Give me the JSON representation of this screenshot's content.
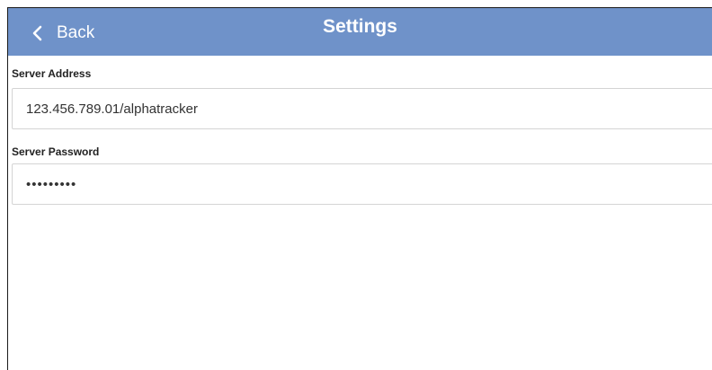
{
  "header": {
    "back_label": "Back",
    "title": "Settings",
    "background_color": "#6f92c9"
  },
  "fields": {
    "server_address": {
      "label": "Server Address",
      "value": "123.456.789.01/alphatracker"
    },
    "server_password": {
      "label": "Server Password",
      "value": "password1"
    }
  },
  "icons": {
    "back": "chevron-left-icon"
  }
}
